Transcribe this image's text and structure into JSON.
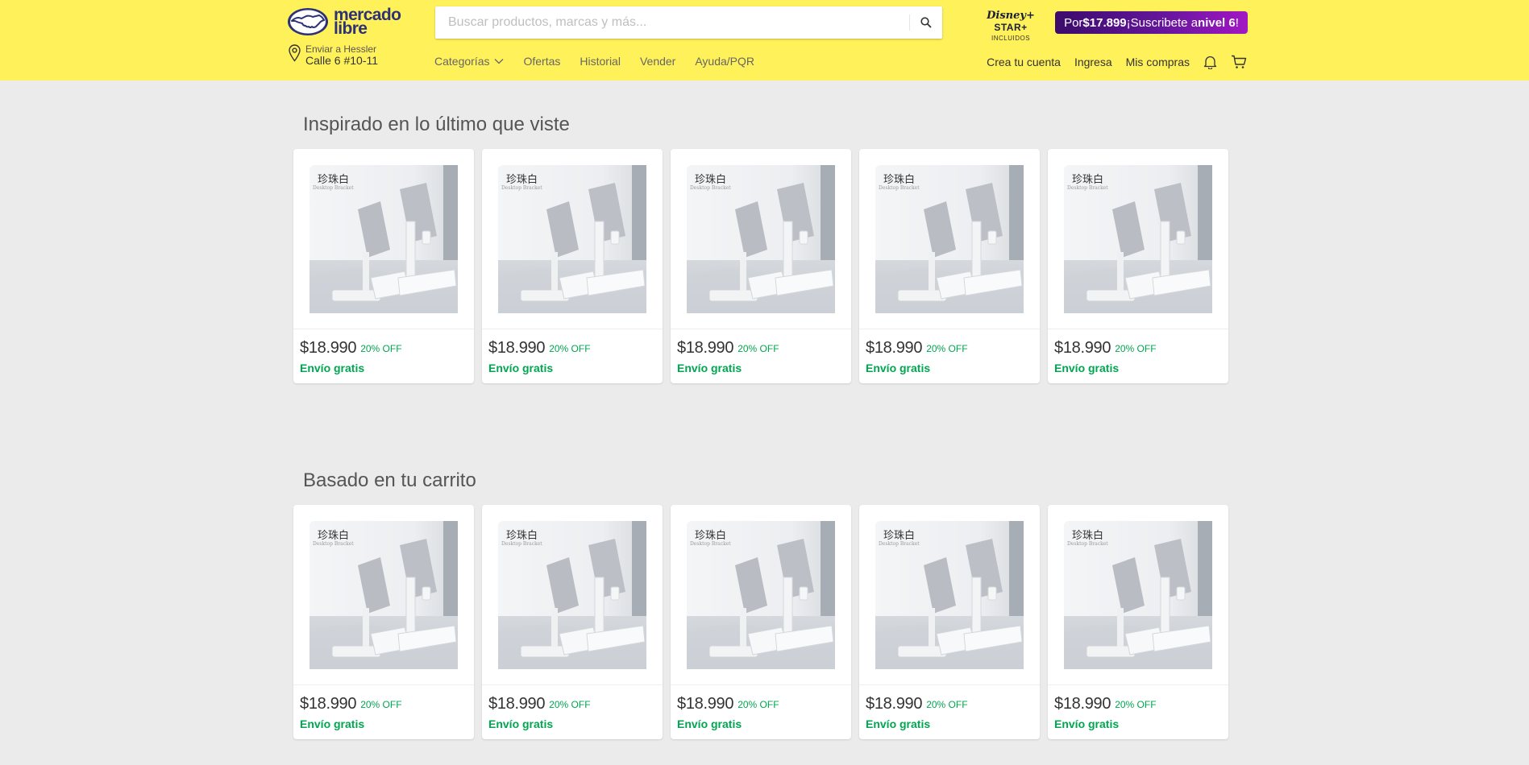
{
  "header": {
    "logo": {
      "line1": "mercado",
      "line2": "libre"
    },
    "search": {
      "placeholder": "Buscar productos, marcas y más..."
    },
    "disney": {
      "brand_disney": "Disney+",
      "brand_star": "STAR+",
      "included": "INCLUIDOS"
    },
    "promo": {
      "prefix": "Por ",
      "price": "$17.899",
      "middle": " ¡Suscribete a ",
      "level": "nivel 6",
      "suffix": "!"
    },
    "location": {
      "label": "Enviar a Hessler",
      "address": "Calle 6 #10-11"
    },
    "nav": [
      "Categorías",
      "Ofertas",
      "Historial",
      "Vender",
      "Ayuda/PQR"
    ],
    "user_nav": [
      "Crea tu cuenta",
      "Ingresa",
      "Mis compras"
    ],
    "colors": {
      "header_bg": "#fff159",
      "brand": "#2d3277",
      "green": "#00a650"
    }
  },
  "sections": [
    {
      "title": "Inspirado en lo último que viste",
      "products": [
        {
          "image_caption": "珍珠白",
          "image_subcaption": "Desktop Bracket",
          "price": "$18.990",
          "discount": "20% OFF",
          "shipping": "Envío gratis"
        },
        {
          "image_caption": "珍珠白",
          "image_subcaption": "Desktop Bracket",
          "price": "$18.990",
          "discount": "20% OFF",
          "shipping": "Envío gratis"
        },
        {
          "image_caption": "珍珠白",
          "image_subcaption": "Desktop Bracket",
          "price": "$18.990",
          "discount": "20% OFF",
          "shipping": "Envío gratis"
        },
        {
          "image_caption": "珍珠白",
          "image_subcaption": "Desktop Bracket",
          "price": "$18.990",
          "discount": "20% OFF",
          "shipping": "Envío gratis"
        },
        {
          "image_caption": "珍珠白",
          "image_subcaption": "Desktop Bracket",
          "price": "$18.990",
          "discount": "20% OFF",
          "shipping": "Envío gratis"
        }
      ]
    },
    {
      "title": "Basado en tu carrito",
      "products": [
        {
          "image_caption": "珍珠白",
          "image_subcaption": "Desktop Bracket",
          "price": "$18.990",
          "discount": "20% OFF",
          "shipping": "Envío gratis"
        },
        {
          "image_caption": "珍珠白",
          "image_subcaption": "Desktop Bracket",
          "price": "$18.990",
          "discount": "20% OFF",
          "shipping": "Envío gratis"
        },
        {
          "image_caption": "珍珠白",
          "image_subcaption": "Desktop Bracket",
          "price": "$18.990",
          "discount": "20% OFF",
          "shipping": "Envío gratis"
        },
        {
          "image_caption": "珍珠白",
          "image_subcaption": "Desktop Bracket",
          "price": "$18.990",
          "discount": "20% OFF",
          "shipping": "Envío gratis"
        },
        {
          "image_caption": "珍珠白",
          "image_subcaption": "Desktop Bracket",
          "price": "$18.990",
          "discount": "20% OFF",
          "shipping": "Envío gratis"
        }
      ]
    }
  ]
}
